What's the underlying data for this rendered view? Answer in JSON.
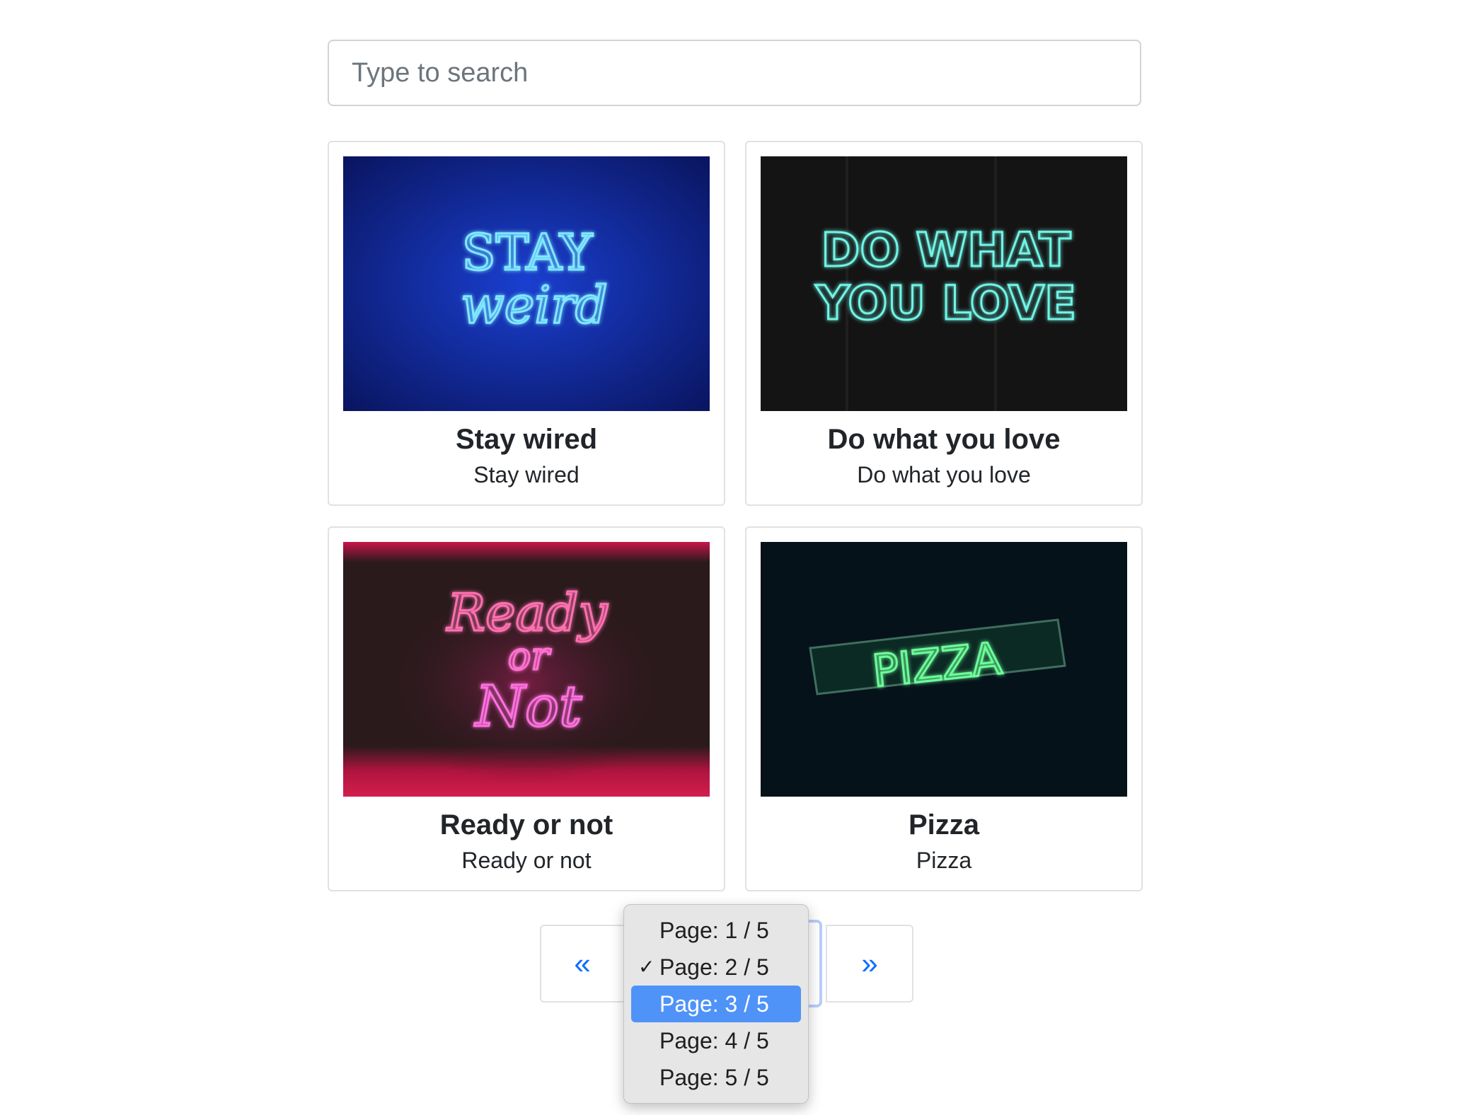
{
  "search": {
    "placeholder": "Type to search"
  },
  "cards": [
    {
      "title": "Stay wired",
      "subtitle": "Stay wired",
      "image": "neon sign 'STAY weird' blue"
    },
    {
      "title": "Do what you love",
      "subtitle": "Do what you love",
      "image": "neon sign 'DO WHAT YOU LOVE' teal"
    },
    {
      "title": "Ready or not",
      "subtitle": "Ready or not",
      "image": "neon sign 'Ready or Not' pink"
    },
    {
      "title": "Pizza",
      "subtitle": "Pizza",
      "image": "neon sign 'PIZZA' green"
    }
  ],
  "card_images": {
    "stay_weird": {
      "line1": "STAY",
      "line2": "weird"
    },
    "do_what": {
      "line1": "DO WHAT",
      "line2": "YOU LOVE"
    },
    "ready": {
      "line1": "Ready",
      "line2": "or",
      "line3": "Not"
    },
    "pizza": {
      "line1": "PIZZA"
    }
  },
  "pagination": {
    "prev_label": "«",
    "next_label": "»",
    "options": [
      "Page: 1 / 5",
      "Page: 2 / 5",
      "Page: 3 / 5",
      "Page: 4 / 5",
      "Page: 5 / 5"
    ],
    "checked_index": 1,
    "highlighted_index": 2,
    "check_mark": "✓"
  },
  "colors": {
    "accent": "#0d6efd",
    "highlight": "#4f93f8"
  }
}
